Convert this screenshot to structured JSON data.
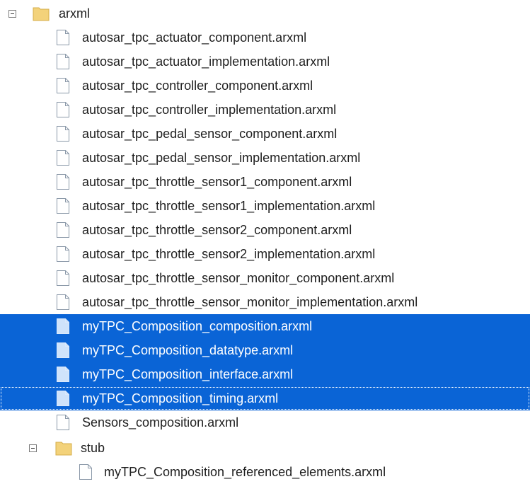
{
  "tree": {
    "root": {
      "label": "arxml",
      "icon": "folder-icon",
      "expanded": true
    },
    "files": [
      {
        "label": "autosar_tpc_actuator_component.arxml",
        "selected": false
      },
      {
        "label": "autosar_tpc_actuator_implementation.arxml",
        "selected": false
      },
      {
        "label": "autosar_tpc_controller_component.arxml",
        "selected": false
      },
      {
        "label": "autosar_tpc_controller_implementation.arxml",
        "selected": false
      },
      {
        "label": "autosar_tpc_pedal_sensor_component.arxml",
        "selected": false
      },
      {
        "label": "autosar_tpc_pedal_sensor_implementation.arxml",
        "selected": false
      },
      {
        "label": "autosar_tpc_throttle_sensor1_component.arxml",
        "selected": false
      },
      {
        "label": "autosar_tpc_throttle_sensor1_implementation.arxml",
        "selected": false
      },
      {
        "label": "autosar_tpc_throttle_sensor2_component.arxml",
        "selected": false
      },
      {
        "label": "autosar_tpc_throttle_sensor2_implementation.arxml",
        "selected": false
      },
      {
        "label": "autosar_tpc_throttle_sensor_monitor_component.arxml",
        "selected": false
      },
      {
        "label": "autosar_tpc_throttle_sensor_monitor_implementation.arxml",
        "selected": false
      },
      {
        "label": "myTPC_Composition_composition.arxml",
        "selected": true
      },
      {
        "label": "myTPC_Composition_datatype.arxml",
        "selected": true
      },
      {
        "label": "myTPC_Composition_interface.arxml",
        "selected": true
      },
      {
        "label": "myTPC_Composition_timing.arxml",
        "selected": true,
        "focused": true
      },
      {
        "label": "Sensors_composition.arxml",
        "selected": false
      }
    ],
    "subfolder": {
      "label": "stub",
      "icon": "folder-icon",
      "expanded": true
    },
    "subfiles": [
      {
        "label": "myTPC_Composition_referenced_elements.arxml",
        "selected": false
      }
    ],
    "colors": {
      "selection": "#0a64d6",
      "folder": "#f3d27a"
    }
  }
}
